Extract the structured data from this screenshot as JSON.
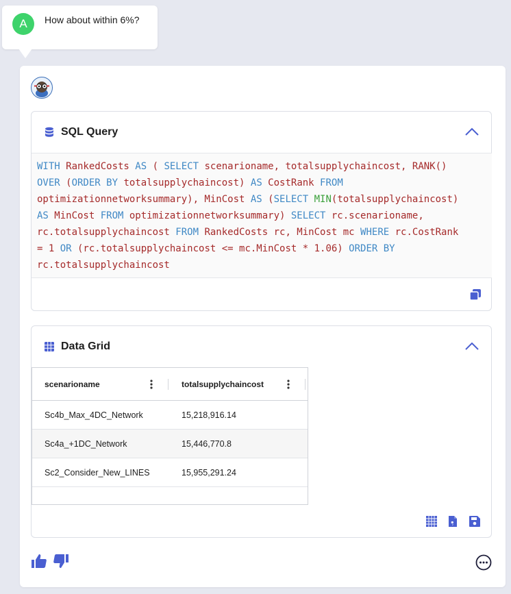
{
  "user_message": {
    "avatar_letter": "A",
    "avatar_color": "#3ed36b",
    "text": "How about within 6%?"
  },
  "sql_panel": {
    "title": "SQL Query",
    "header_icon": "database-icon",
    "accent_color": "#4a5fd1"
  },
  "data_grid": {
    "title": "Data Grid",
    "header_icon": "grid-icon",
    "columns": [
      "scenarioname",
      "totalsupplychaincost"
    ],
    "rows": [
      [
        "Sc4b_Max_4DC_Network",
        "15,218,916.14"
      ],
      [
        "Sc4a_+1DC_Network",
        "15,446,770.8"
      ],
      [
        "Sc2_Consider_New_LINES",
        "15,955,291.24"
      ]
    ]
  }
}
